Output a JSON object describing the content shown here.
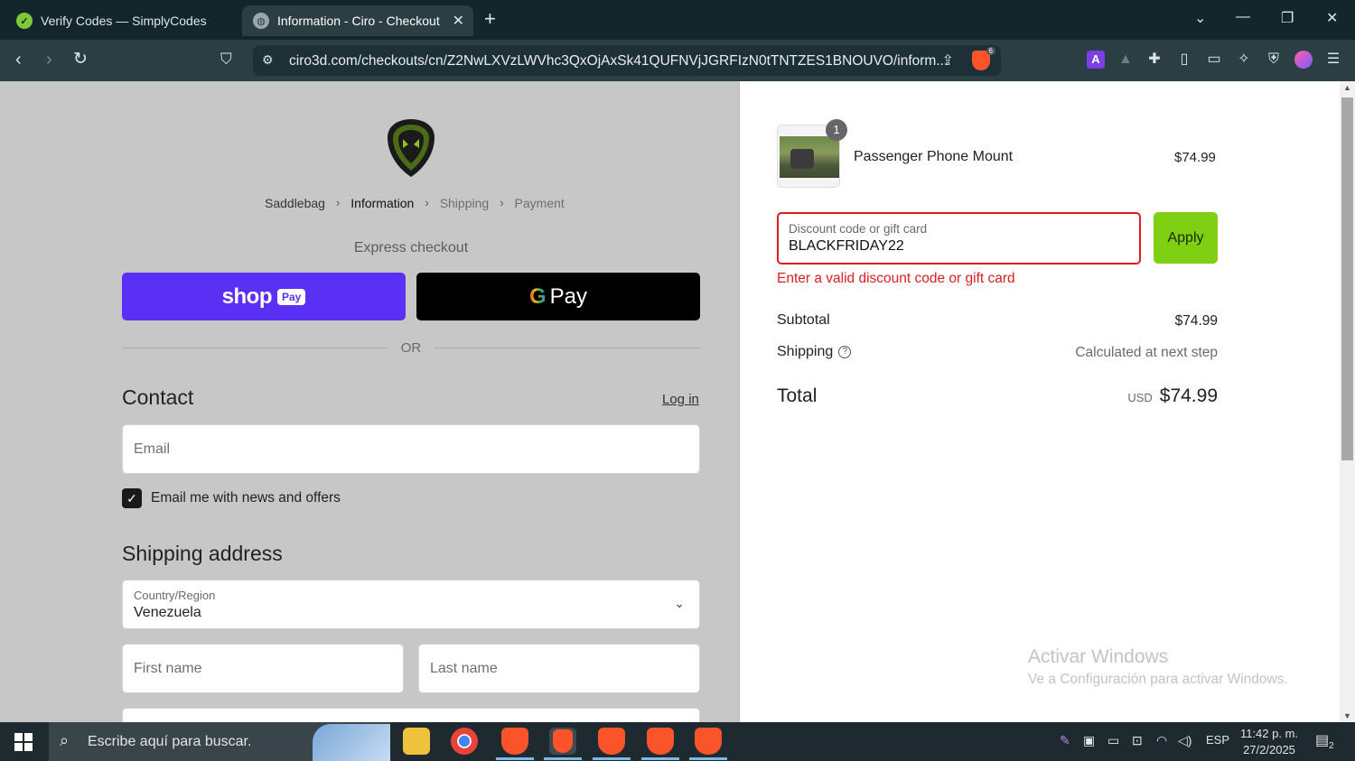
{
  "browser": {
    "tabs": [
      {
        "title": "Verify Codes — SimplyCodes",
        "icon": "simplycodes-icon"
      },
      {
        "title": "Information - Ciro - Checkout",
        "icon": "globe-icon",
        "active": true
      }
    ],
    "url": "ciro3d.com/checkouts/cn/Z2NwLXVzLWVhc3QxOjAxSk41QUFNVjJGRFIzN0tTNTZES1BNOUVO/inform...",
    "brave_badge": "6"
  },
  "checkout": {
    "breadcrumb": [
      "Saddlebag",
      "Information",
      "Shipping",
      "Payment"
    ],
    "express_checkout": "Express checkout",
    "shop_pay": {
      "word": "shop",
      "badge": "Pay"
    },
    "google_pay": {
      "g": "G",
      "label": "Pay"
    },
    "or": "OR",
    "contact_title": "Contact",
    "login": "Log in",
    "email_placeholder": "Email",
    "newsletter_label": "Email me with news and offers",
    "newsletter_checked": true,
    "shipping_title": "Shipping address",
    "country_label": "Country/Region",
    "country_value": "Venezuela",
    "first_name_placeholder": "First name",
    "last_name_placeholder": "Last name"
  },
  "summary": {
    "quantity": "1",
    "product_name": "Passenger Phone Mount",
    "product_price": "$74.99",
    "discount_label": "Discount code or gift card",
    "discount_value": "BLACKFRIDAY22",
    "apply": "Apply",
    "error": "Enter a valid discount code or gift card",
    "subtotal_label": "Subtotal",
    "subtotal_value": "$74.99",
    "shipping_label": "Shipping",
    "shipping_value": "Calculated at next step",
    "total_label": "Total",
    "total_currency": "USD",
    "total_value": "$74.99"
  },
  "watermark": {
    "title": "Activar Windows",
    "subtitle": "Ve a Configuración para activar Windows."
  },
  "taskbar": {
    "search_placeholder": "Escribe aquí para buscar.",
    "language": "ESP",
    "time": "11:42 p. m.",
    "date": "27/2/2025",
    "notifications": "2"
  },
  "colors": {
    "shop_pay": "#5a31f4",
    "apply": "#7fcf13",
    "error": "#d82020"
  }
}
